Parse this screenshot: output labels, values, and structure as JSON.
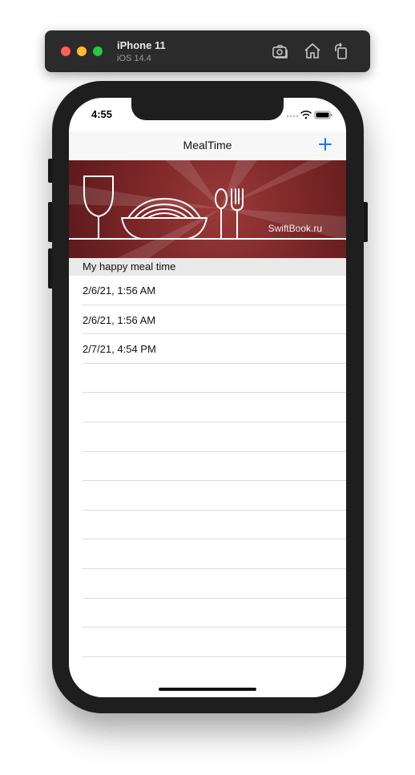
{
  "simulator": {
    "device_name": "iPhone 11",
    "os_version": "iOS 14.4",
    "icons": [
      "screenshot-icon",
      "home-icon",
      "rotate-icon"
    ]
  },
  "status_bar": {
    "time": "4:55",
    "icons": [
      "signal-dots-icon",
      "wifi-icon",
      "battery-icon"
    ]
  },
  "navbar": {
    "title": "MealTime",
    "add_icon": "plus-icon"
  },
  "banner": {
    "brand_text": "SwiftBook.ru",
    "icons": [
      "wine-glass-icon",
      "spaghetti-bowl-icon",
      "spoon-icon",
      "fork-icon"
    ]
  },
  "section": {
    "title": "My happy meal time"
  },
  "meals": [
    "2/6/21, 1:56 AM",
    "2/6/21, 1:56 AM",
    "2/7/21, 4:54 PM",
    "",
    "",
    "",
    "",
    "",
    "",
    "",
    "",
    "",
    ""
  ],
  "colors": {
    "accent": "#0a7aff",
    "banner": "#7a2627"
  }
}
